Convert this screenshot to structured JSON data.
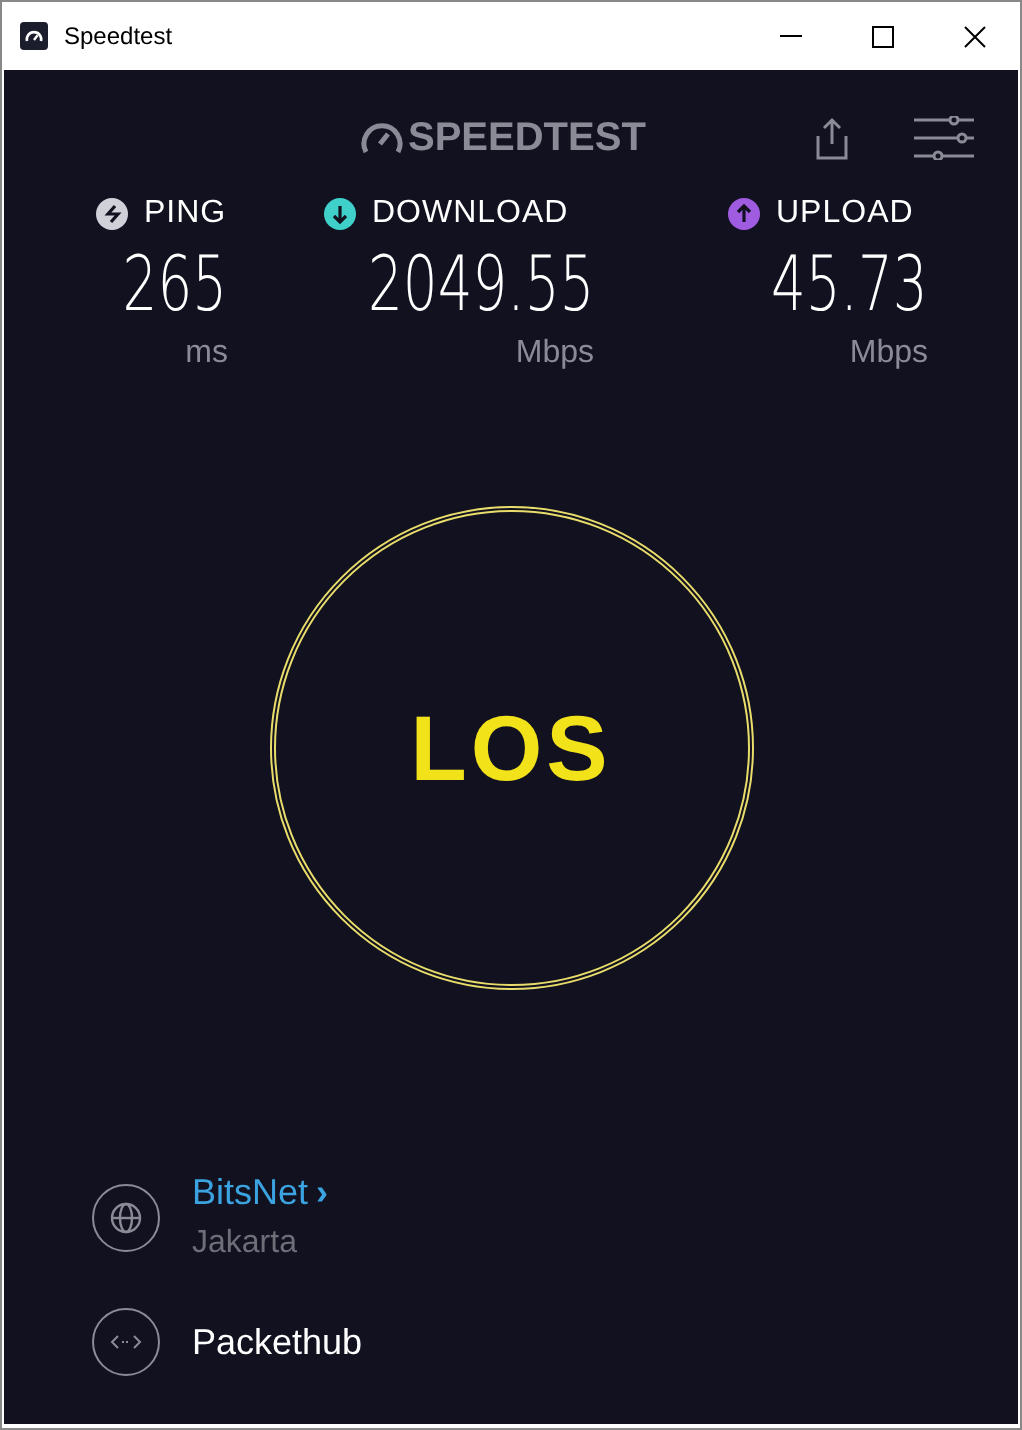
{
  "window": {
    "title": "Speedtest"
  },
  "header": {
    "logo": "SPEEDTEST"
  },
  "metrics": [
    {
      "kind": "ping",
      "label": "PING",
      "value": "265",
      "unit": "ms",
      "color": "#d0d0d8"
    },
    {
      "kind": "download",
      "label": "DOWNLOAD",
      "value": "2049.55",
      "unit": "Mbps",
      "color": "#3fd0c9"
    },
    {
      "kind": "upload",
      "label": "UPLOAD",
      "value": "45.73",
      "unit": "Mbps",
      "color": "#a05ce0"
    }
  ],
  "go_button": {
    "label": "LOS"
  },
  "servers": [
    {
      "kind": "isp",
      "name": "BitsNet",
      "chevron": "›",
      "location": "Jakarta"
    },
    {
      "kind": "host",
      "name": "Packethub"
    }
  ]
}
